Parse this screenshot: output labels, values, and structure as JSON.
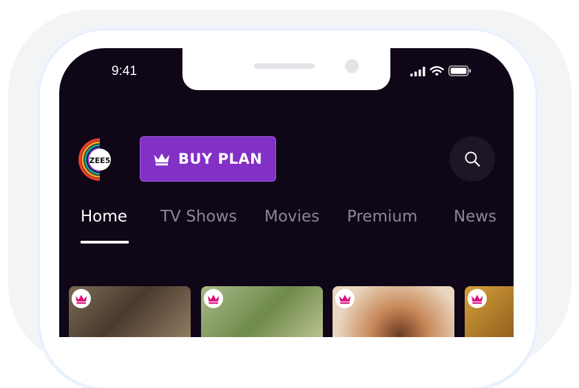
{
  "status_bar": {
    "time": "9:41",
    "icons": [
      "signal-icon",
      "wifi-icon",
      "battery-icon"
    ]
  },
  "header": {
    "logo_text": "ZEE5",
    "buy_plan_label": "BUY PLAN",
    "buy_plan_icon": "crown-icon",
    "search_icon": "search-icon"
  },
  "tabs": [
    {
      "label": "Home",
      "active": true
    },
    {
      "label": "TV Shows",
      "active": false
    },
    {
      "label": "Movies",
      "active": false
    },
    {
      "label": "Premium",
      "active": false
    },
    {
      "label": "News",
      "active": false
    }
  ],
  "cards": [
    {
      "badge_icon": "crown-icon",
      "premium": true
    },
    {
      "badge_icon": "crown-icon",
      "premium": true
    },
    {
      "badge_icon": "crown-icon",
      "premium": true
    },
    {
      "badge_icon": "crown-icon",
      "premium": true
    }
  ],
  "colors": {
    "screen_background": "#0f0617",
    "accent_purple": "#8230c6",
    "badge_crown": "#d8127e",
    "tab_inactive": "#8e8793",
    "tab_active": "#ffffff"
  }
}
